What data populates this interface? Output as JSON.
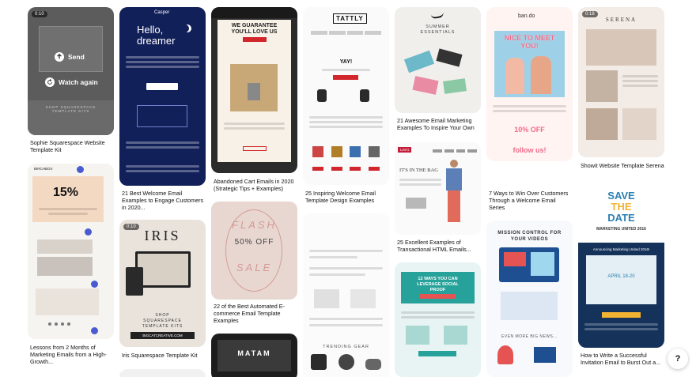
{
  "colors": {
    "dark_overlay": "#5c5c5c",
    "casper_navy": "#12205a",
    "tattly_red": "#d1262c",
    "bando_pink": "#f06b8a",
    "save_date_teal": "#2b7fb0",
    "marketing_navy": "#15325a"
  },
  "pins": {
    "c1a": {
      "badge": "0:10",
      "send_label": "Send",
      "watch_label": "Watch again",
      "caption": "Sophie Squarespace Website Template Kit",
      "send_icon": "upload-arrow-icon",
      "watch_icon": "replay-icon"
    },
    "c1b": {
      "caption": "Lessons from 2 Months of Marketing Emails from a High-Growth...",
      "big_text": "15%",
      "logo": "BIRCHBOX"
    },
    "c2a": {
      "caption": "21 Best Welcome Email Examples to Engage Customers in 2020...",
      "logo": "Casper",
      "headline": "Hello, dreamer"
    },
    "c2b": {
      "badge": "0:10",
      "caption": "Iris Squarespace Template Kit",
      "title": "IRIS",
      "footer": "SHOP SQUARESPACE TEMPLATE KITS",
      "url": "BIGCATCREATIVE.COM"
    },
    "c3a": {
      "caption": "Abandoned Cart Emails in 2020 (Strategic Tips + Examples)",
      "headline": "WE GUARANTEE YOU'LL LOVE US"
    },
    "c3b": {
      "caption": "22 of the Best Automated E-commerce Email Template Examples",
      "flash": "FLASH",
      "offer": "50% OFF",
      "sale": "SALE"
    },
    "c3c": {
      "title": "MATAM"
    },
    "c4a": {
      "caption": "25 Inspiring Welcome Email Template Design Examples",
      "logo": "TATTLY",
      "greeting": "YAY!"
    },
    "c4b": {
      "footer": "TRENDING GEAR"
    },
    "c5a": {
      "caption": "21 Awesome Email Marketing Examples To Inspire Your Own",
      "title": "SUMMER ESSENTIALS"
    },
    "c5b": {
      "caption": "25 Excellent Examples of Transactional HTML Emails...",
      "tagline": "IT'S IN THE BAG",
      "logo": "Levi's"
    },
    "c5c": {
      "headline": "12 WAYS YOU CAN LEVERAGE SOCIAL PROOF"
    },
    "c6a": {
      "caption": "7 Ways to Win Over Customers Through a Welcome Email Series",
      "logo": "ban.do",
      "headline": "NICE TO MEET YOU!",
      "offer": "10% OFF",
      "follow": "follow us!"
    },
    "c6b": {
      "headline": "MISSION CONTROL FOR YOUR VIDEOS",
      "footer": "EVEN MORE BIG NEWS..."
    },
    "c7a": {
      "badge": "0:18",
      "caption": "Showit Website Template Serena",
      "title": "SERENA"
    },
    "c7b": {
      "caption": "How to Write a Successful Invitation Email to Burst Out a...",
      "headline1": "SAVE",
      "headline2": "THE",
      "headline3": "DATE",
      "event": "MARKETING UNITED 2016",
      "subhead": "Announcing Marketing United 2016!",
      "date": "APRIL 18-20"
    }
  },
  "help": {
    "label": "?"
  }
}
